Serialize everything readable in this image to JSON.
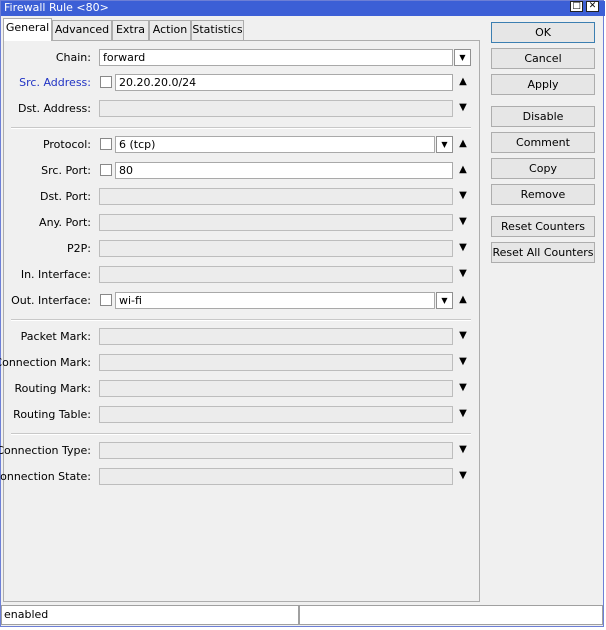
{
  "window": {
    "title": "Firewall Rule <80>"
  },
  "tabs": [
    {
      "label": "General"
    },
    {
      "label": "Advanced"
    },
    {
      "label": "Extra"
    },
    {
      "label": "Action"
    },
    {
      "label": "Statistics"
    }
  ],
  "fields": {
    "chain": {
      "label": "Chain:",
      "value": "forward"
    },
    "src_address": {
      "label": "Src. Address:",
      "value": "20.20.20.0/24"
    },
    "dst_address": {
      "label": "Dst. Address:",
      "value": ""
    },
    "protocol": {
      "label": "Protocol:",
      "value": "6 (tcp)"
    },
    "src_port": {
      "label": "Src. Port:",
      "value": "80"
    },
    "dst_port": {
      "label": "Dst. Port:",
      "value": ""
    },
    "any_port": {
      "label": "Any. Port:",
      "value": ""
    },
    "p2p": {
      "label": "P2P:",
      "value": ""
    },
    "in_interface": {
      "label": "In. Interface:",
      "value": ""
    },
    "out_interface": {
      "label": "Out. Interface:",
      "value": "wi-fi"
    },
    "packet_mark": {
      "label": "Packet Mark:",
      "value": ""
    },
    "connection_mark": {
      "label": "Connection Mark:",
      "value": ""
    },
    "routing_mark": {
      "label": "Routing Mark:",
      "value": ""
    },
    "routing_table": {
      "label": "Routing Table:",
      "value": ""
    },
    "connection_type": {
      "label": "Connection Type:",
      "value": ""
    },
    "connection_state": {
      "label": "Connection State:",
      "value": ""
    }
  },
  "buttons": {
    "ok": "OK",
    "cancel": "Cancel",
    "apply": "Apply",
    "disable": "Disable",
    "comment": "Comment",
    "copy": "Copy",
    "remove": "Remove",
    "reset_counters": "Reset Counters",
    "reset_all_counters": "Reset All Counters"
  },
  "status": {
    "text": "enabled",
    "extra": ""
  },
  "colors": {
    "titlebar": "#3c5fd6",
    "label_highlight": "#2033c4"
  }
}
